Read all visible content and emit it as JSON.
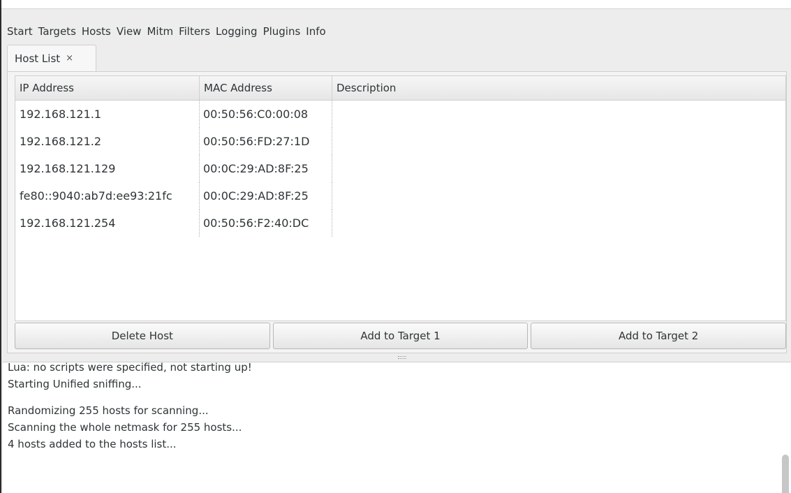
{
  "menu": [
    "Start",
    "Targets",
    "Hosts",
    "View",
    "Mitm",
    "Filters",
    "Logging",
    "Plugins",
    "Info"
  ],
  "tab": {
    "label": "Host List",
    "close": "×"
  },
  "table": {
    "headers": [
      "IP Address",
      "MAC Address",
      "Description"
    ],
    "rows": [
      {
        "ip": "192.168.121.1",
        "mac": "00:50:56:C0:00:08",
        "desc": ""
      },
      {
        "ip": "192.168.121.2",
        "mac": "00:50:56:FD:27:1D",
        "desc": ""
      },
      {
        "ip": "192.168.121.129",
        "mac": "00:0C:29:AD:8F:25",
        "desc": ""
      },
      {
        "ip": "fe80::9040:ab7d:ee93:21fc",
        "mac": "00:0C:29:AD:8F:25",
        "desc": ""
      },
      {
        "ip": "192.168.121.254",
        "mac": "00:50:56:F2:40:DC",
        "desc": ""
      }
    ]
  },
  "buttons": {
    "delete": "Delete Host",
    "target1": "Add to Target 1",
    "target2": "Add to Target 2"
  },
  "log": [
    "Lua: no scripts were specified, not starting up!",
    "Starting Unified sniffing...",
    "",
    "Randomizing 255 hosts for scanning...",
    "Scanning the whole netmask for 255 hosts...",
    "4 hosts added to the hosts list..."
  ]
}
